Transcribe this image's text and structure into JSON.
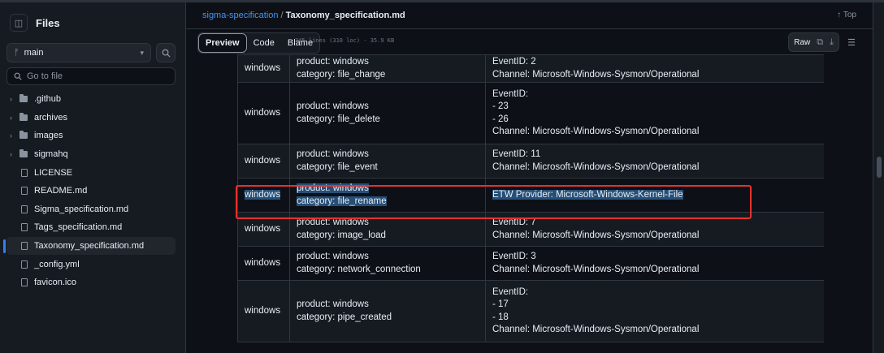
{
  "sidebar": {
    "title": "Files",
    "branch": "main",
    "goto_placeholder": "Go to file",
    "tree": [
      {
        "type": "folder",
        "label": ".github"
      },
      {
        "type": "folder",
        "label": "archives"
      },
      {
        "type": "folder",
        "label": "images"
      },
      {
        "type": "folder",
        "label": "sigmahq"
      },
      {
        "type": "file",
        "label": "LICENSE"
      },
      {
        "type": "file",
        "label": "README.md"
      },
      {
        "type": "file",
        "label": "Sigma_specification.md"
      },
      {
        "type": "file",
        "label": "Tags_specification.md"
      },
      {
        "type": "file",
        "label": "Taxonomy_specification.md",
        "selected": true
      },
      {
        "type": "file",
        "label": "_config.yml"
      },
      {
        "type": "file",
        "label": "favicon.ico"
      }
    ]
  },
  "header": {
    "repo": "sigma-specification",
    "sep": "/",
    "file": "Taxonomy_specification.md",
    "top": "Top"
  },
  "toolbar": {
    "tabs": [
      "Preview",
      "Code",
      "Blame"
    ],
    "meta": "345 lines (310 loc) · 35.9 KB",
    "raw": "Raw"
  },
  "table": {
    "rows": [
      {
        "product": "windows",
        "logsource": [
          "product: windows",
          "category: file_change"
        ],
        "event": [
          "EventID: 2",
          "Channel: Microsoft-Windows-Sysmon/Operational"
        ]
      },
      {
        "product": "windows",
        "logsource": [
          "product: windows",
          "category: file_delete"
        ],
        "event": [
          "EventID:",
          "- 23",
          "- 26",
          "Channel: Microsoft-Windows-Sysmon/Operational"
        ]
      },
      {
        "product": "windows",
        "logsource": [
          "product: windows",
          "category: file_event"
        ],
        "event": [
          "EventID: 11",
          "Channel: Microsoft-Windows-Sysmon/Operational"
        ]
      },
      {
        "product": "windows",
        "logsource": [
          "product: windows",
          "category: file_rename"
        ],
        "event": [
          "ETW Provider: Microsoft-Windows-Kernel-File"
        ],
        "highlighted": true
      },
      {
        "product": "windows",
        "logsource": [
          "product: windows",
          "category: image_load"
        ],
        "event": [
          "EventID: 7",
          "Channel: Microsoft-Windows-Sysmon/Operational"
        ]
      },
      {
        "product": "windows",
        "logsource": [
          "product: windows",
          "category: network_connection"
        ],
        "event": [
          "EventID: 3",
          "Channel: Microsoft-Windows-Sysmon/Operational"
        ]
      },
      {
        "product": "windows",
        "logsource": [
          "product: windows",
          "category: pipe_created"
        ],
        "event": [
          "EventID:",
          "- 17",
          "- 18",
          "Channel: Microsoft-Windows-Sysmon/Operational"
        ]
      }
    ]
  },
  "colors": {
    "accent": "#2f81f7",
    "highlight": "#264f78",
    "annotation_box": "#e5322d"
  }
}
